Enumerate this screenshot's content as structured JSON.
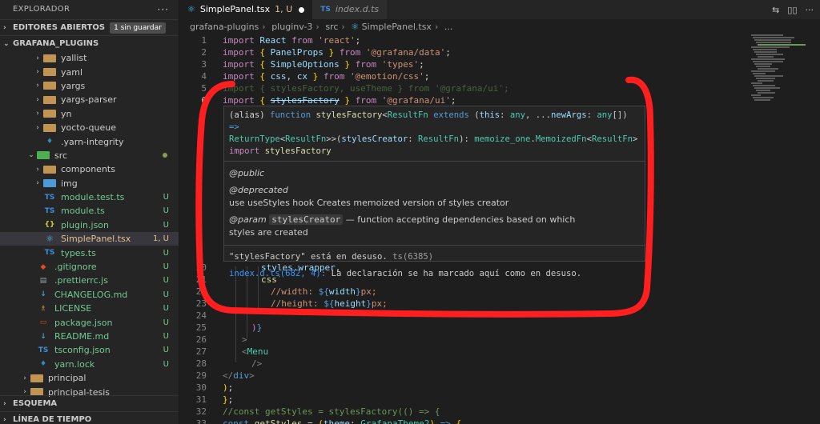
{
  "sidebar": {
    "title": "EXPLORADOR",
    "more": "···",
    "open_editors": {
      "label": "EDITORES ABIERTOS",
      "badge": "1 sin guardar"
    },
    "workspace": "GRAFANA_PLUGINS",
    "items": [
      {
        "name": "yallist",
        "type": "folder"
      },
      {
        "name": "yaml",
        "type": "folder"
      },
      {
        "name": "yargs",
        "type": "folder"
      },
      {
        "name": "yargs-parser",
        "type": "folder"
      },
      {
        "name": "yn",
        "type": "folder"
      },
      {
        "name": "yocto-queue",
        "type": "folder"
      },
      {
        "name": ".yarn-integrity",
        "type": "yarn"
      },
      {
        "name": "src",
        "type": "folder-src"
      },
      {
        "name": "components",
        "type": "folder"
      },
      {
        "name": "img",
        "type": "folder-blue"
      },
      {
        "name": "module.test.ts",
        "type": "ts",
        "status": "U"
      },
      {
        "name": "module.ts",
        "type": "ts",
        "status": "U"
      },
      {
        "name": "plugin.json",
        "type": "json",
        "status": "U"
      },
      {
        "name": "SimplePanel.tsx",
        "type": "react",
        "status": "1, U"
      },
      {
        "name": "types.ts",
        "type": "ts",
        "status": "U"
      },
      {
        "name": ".gitignore",
        "type": "git",
        "status": "U"
      },
      {
        "name": ".prettierrc.js",
        "type": "prettier",
        "status": "U"
      },
      {
        "name": "CHANGELOG.md",
        "type": "md",
        "status": "U"
      },
      {
        "name": "LICENSE",
        "type": "license",
        "status": "U"
      },
      {
        "name": "package.json",
        "type": "pkg",
        "status": "U"
      },
      {
        "name": "README.md",
        "type": "md",
        "status": "U"
      },
      {
        "name": "tsconfig.json",
        "type": "ts",
        "status": "U"
      },
      {
        "name": "yarn.lock",
        "type": "yarn",
        "status": "U"
      },
      {
        "name": "principal",
        "type": "folder"
      },
      {
        "name": "principal-tesis",
        "type": "folder"
      }
    ],
    "outline": "ESQUEMA",
    "timeline": "LÍNEA DE TIEMPO"
  },
  "tabs": [
    {
      "icon": "react-icon",
      "label": "SimplePanel.tsx",
      "status": "1, U",
      "active": true
    },
    {
      "icon": "TS",
      "label": "index.d.ts",
      "active": false
    }
  ],
  "breadcrumb": [
    "grafana-plugins",
    "pluginv-3",
    "src",
    "SimplePanel.tsx",
    "..."
  ],
  "hover": {
    "sig_line1": "(alias) function stylesFactory<ResultFn extends (this: any, ...newArgs: any[]) =>",
    "sig_line2": "ReturnType<ResultFn>>(stylesCreator: ResultFn): memoize_one.MemoizedFn<ResultFn>",
    "sig_line3": "import stylesFactory",
    "tag_public": "@public",
    "tag_deprecated": "@deprecated",
    "deprecated_text": "use useStyles hook Creates memoized version of styles creator",
    "tag_param": "@param",
    "param_name": "stylesCreator",
    "param_text": "— function accepting dependencies based on which",
    "param_text2": "styles are created",
    "diag1": "\"stylesFactory\" está en desuso.",
    "diag1_code": "ts(6385)",
    "diag2_link": "index.d.ts(682, 4):",
    "diag2_text": "La declaración se ha marcado aquí como en desuso."
  },
  "code_lines": {
    "l1": "import React from 'react';",
    "l2": "import { PanelProps } from '@grafana/data';",
    "l3": "import { SimpleOptions } from 'types';",
    "l4": "import { css, cx } from '@emotion/css';",
    "l5": "import { stylesFactory, useTheme } from '@grafana/ui';",
    "l6": "import { stylesFactory } from '@grafana/ui';",
    "l20": "styles.wrapper,",
    "l21": "css`",
    "l22": "//width: ${width}px;",
    "l23": "//height: ${height}px;",
    "l24": "`",
    "l25": ")}",
    "l26": ">",
    "l27": "<Menu",
    "l28": "/>",
    "l29": "</div>",
    "l30": ");",
    "l31": "};",
    "l32": "//const getStyles = stylesFactory(() => {",
    "l33": "const getStyles = (theme: GrafanaTheme2) => {"
  },
  "accent_color": "#ff1f1f"
}
